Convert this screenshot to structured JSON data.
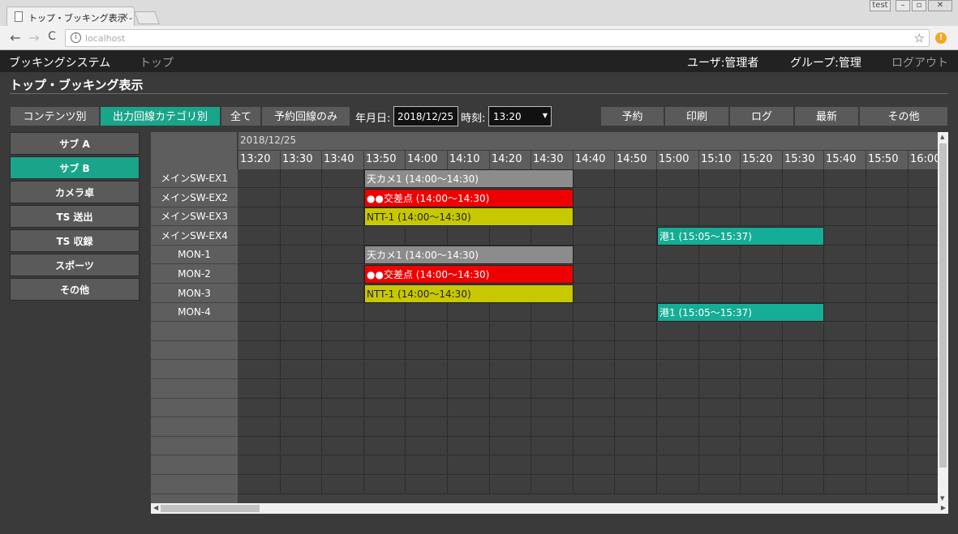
{
  "browser": {
    "tab_title": "トップ・ブッキング表示 - 回線",
    "tab_close": "×",
    "profile": "test",
    "url": "localhost",
    "info_glyph": "i",
    "star_glyph": "☆",
    "ext_glyph": "!",
    "back": "←",
    "forward": "→",
    "reload": "C"
  },
  "appbar": {
    "app_name": "ブッキングシステム",
    "nav_top": "トップ",
    "user": "ユーザ:管理者",
    "group": "グループ:管理",
    "logout": "ログアウト"
  },
  "page": {
    "title": "トップ・ブッキング表示"
  },
  "toolbar": {
    "by_content": "コンテンツ別",
    "by_output_category": "出力回線カテゴリ別",
    "all": "全て",
    "booked_only": "予約回線のみ",
    "date_label": "年月日:",
    "date_value": "2018/12/25",
    "time_label": "時刻:",
    "time_value": "13:20",
    "reserve": "予約",
    "print": "印刷",
    "log": "ログ",
    "refresh": "最新",
    "other": "その他"
  },
  "sidebar": {
    "items": [
      {
        "label": "サブ A",
        "active": false
      },
      {
        "label": "サブ B",
        "active": true
      },
      {
        "label": "カメラ卓",
        "active": false
      },
      {
        "label": "TS 送出",
        "active": false
      },
      {
        "label": "TS 収録",
        "active": false
      },
      {
        "label": "スポーツ",
        "active": false
      },
      {
        "label": "その他",
        "active": false
      }
    ]
  },
  "schedule": {
    "date": "2018/12/25",
    "times": [
      "13:20",
      "13:30",
      "13:40",
      "13:50",
      "14:00",
      "14:10",
      "14:20",
      "14:30",
      "14:40",
      "14:50",
      "15:00",
      "15:10",
      "15:20",
      "15:30",
      "15:40",
      "15:50",
      "16:00"
    ],
    "rows": [
      "メインSW-EX1",
      "メインSW-EX2",
      "メインSW-EX3",
      "メインSW-EX4",
      "MON-1",
      "MON-2",
      "MON-3",
      "MON-4",
      "",
      "",
      "",
      "",
      "",
      "",
      "",
      "",
      ""
    ],
    "bookings": [
      {
        "row": 0,
        "start": "13:50",
        "end": "14:40",
        "label": "天カメ1 (14:00〜14:30)",
        "color": "gray"
      },
      {
        "row": 1,
        "start": "13:50",
        "end": "14:40",
        "label": "●●交差点 (14:00〜14:30)",
        "color": "red"
      },
      {
        "row": 2,
        "start": "13:50",
        "end": "14:40",
        "label": "NTT-1 (14:00〜14:30)",
        "color": "yellow"
      },
      {
        "row": 3,
        "start": "15:00",
        "end": "15:40",
        "label": "港1 (15:05〜15:37)",
        "color": "teal"
      },
      {
        "row": 4,
        "start": "13:50",
        "end": "14:40",
        "label": "天カメ1 (14:00〜14:30)",
        "color": "gray"
      },
      {
        "row": 5,
        "start": "13:50",
        "end": "14:40",
        "label": "●●交差点 (14:00〜14:30)",
        "color": "red"
      },
      {
        "row": 6,
        "start": "13:50",
        "end": "14:40",
        "label": "NTT-1 (14:00〜14:30)",
        "color": "yellow"
      },
      {
        "row": 7,
        "start": "15:00",
        "end": "15:40",
        "label": "港1 (15:05〜15:37)",
        "color": "teal"
      }
    ]
  },
  "scrollbar": {
    "up": "▲",
    "down": "▼",
    "left": "◀",
    "right": "▶"
  },
  "colors": {
    "accent": "#1aa58a",
    "gray": "#8c8c8c",
    "red": "#ee0000",
    "yellow": "#c8c800",
    "teal": "#15ad95"
  }
}
